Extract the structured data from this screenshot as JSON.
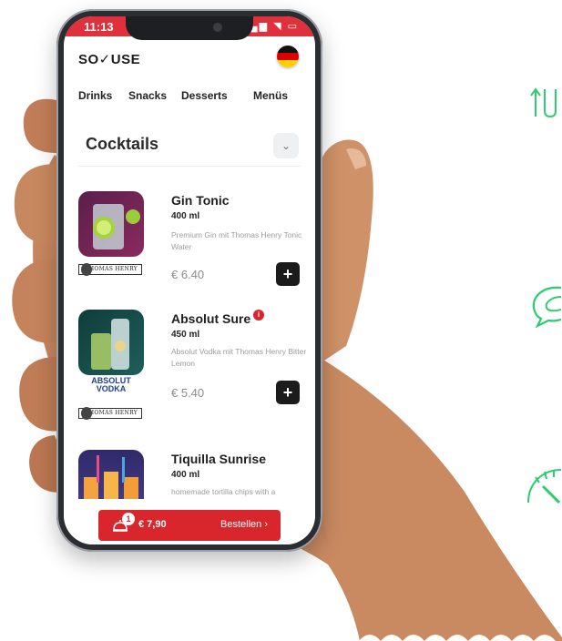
{
  "status": {
    "time": "11:13",
    "indicators": "▂▄▆ ◥ ▭"
  },
  "brand": {
    "logo": "SO✓USE"
  },
  "language": {
    "flag": "german-flag",
    "colors": [
      "#111111",
      "#dd0000",
      "#ffce00"
    ]
  },
  "nav": {
    "items": [
      "Drinks",
      "Snacks",
      "Desserts",
      "Menüs"
    ]
  },
  "section": {
    "title": "Cocktails",
    "toggle_icon": "chevron-down-icon"
  },
  "items": [
    {
      "name": "Gin Tonic",
      "volume": "400 ml",
      "description": "Premium Gin mit Thomas Henry Tonic Water",
      "price": "€ 6.40",
      "add_label": "+",
      "brand_tag": "THOMAS HENRY"
    },
    {
      "name": "Absolut Sure",
      "volume": "450 ml",
      "description": "Absolut Vodka mit Thomas Henry Bitter Lemon",
      "price": "€ 5.40",
      "add_label": "+",
      "info_badge": "i",
      "vodka_tag_line1": "ABSOLUT",
      "vodka_tag_line2": "VODKA",
      "brand_tag": "THOMAS HENRY"
    },
    {
      "name": "Tiquilla Sunrise",
      "volume": "400 ml",
      "description": "homemade tortilla chips with a"
    }
  ],
  "cart": {
    "count": "1",
    "total": "€ 7,90",
    "order_label": "Bestellen ›"
  },
  "colors": {
    "accent": "#d9262c",
    "statusbar": "#e0303b",
    "side_icons": "#2ecc71"
  }
}
